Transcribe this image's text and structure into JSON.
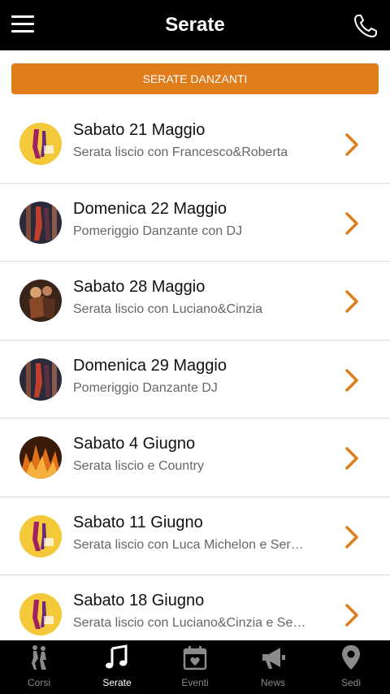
{
  "header": {
    "title": "Serate"
  },
  "banner": {
    "label": "SERATE DANZANTI"
  },
  "events": [
    {
      "date": "Sabato 21 Maggio",
      "desc": "Serata liscio con Francesco&Roberta"
    },
    {
      "date": "Domenica 22 Maggio",
      "desc": "Pomeriggio Danzante con DJ"
    },
    {
      "date": "Sabato 28 Maggio",
      "desc": "Serata liscio con Luciano&Cinzia"
    },
    {
      "date": "Domenica 29 Maggio",
      "desc": "Pomeriggio Danzante DJ"
    },
    {
      "date": "Sabato 4 Giugno",
      "desc": "Serata liscio e Country"
    },
    {
      "date": "Sabato 11 Giugno",
      "desc": "Serata liscio con Luca Michelon e Ser…"
    },
    {
      "date": "Sabato 18 Giugno",
      "desc": "Serata liscio con Luciano&Cinzia e Se…"
    }
  ],
  "tabs": [
    {
      "label": "Corsi",
      "icon": "dancers-icon"
    },
    {
      "label": "Serate",
      "icon": "music-note-icon"
    },
    {
      "label": "Eventi",
      "icon": "calendar-icon"
    },
    {
      "label": "News",
      "icon": "megaphone-icon"
    },
    {
      "label": "Sedi",
      "icon": "location-pin-icon"
    }
  ],
  "colors": {
    "accent": "#e07d1a",
    "bar": "#000000",
    "active_tab": "#ffffff",
    "inactive_tab": "#8a8a8a"
  }
}
